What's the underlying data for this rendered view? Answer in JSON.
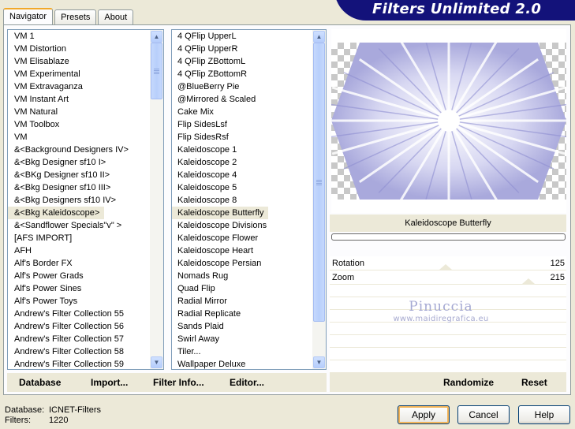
{
  "tabs": [
    "Navigator",
    "Presets",
    "About"
  ],
  "title": "Filters Unlimited 2.0",
  "categories": {
    "items": [
      "VM 1",
      "VM Distortion",
      "VM Elisablaze",
      "VM Experimental",
      "VM Extravaganza",
      "VM Instant Art",
      "VM Natural",
      "VM Toolbox",
      "VM",
      "&<Background Designers IV>",
      "&<Bkg Designer sf10 I>",
      "&<BKg Designer sf10 II>",
      "&<Bkg Designer sf10 III>",
      "&<Bkg Designers sf10 IV>",
      "&<Bkg Kaleidoscope>",
      "&<Sandflower Specials\"v\" >",
      "[AFS IMPORT]",
      "AFH",
      "Alf's Border FX",
      "Alf's Power Grads",
      "Alf's Power Sines",
      "Alf's Power Toys",
      "Andrew's Filter Collection 55",
      "Andrew's Filter Collection 56",
      "Andrew's Filter Collection 57",
      "Andrew's Filter Collection 58",
      "Andrew's Filter Collection 59"
    ],
    "selected_index": 14,
    "scroll_thumb_fraction": 0.1
  },
  "filters": {
    "items": [
      "4 QFlip UpperL",
      "4 QFlip UpperR",
      "4 QFlip ZBottomL",
      "4 QFlip ZBottomR",
      "@BlueBerry Pie",
      "@Mirrored & Scaled",
      "Cake Mix",
      "Flip SidesLsf",
      "Flip SidesRsf",
      "Kaleidoscope 1",
      "Kaleidoscope 2",
      "Kaleidoscope 4",
      "Kaleidoscope 5",
      "Kaleidoscope 8",
      "Kaleidoscope Butterfly",
      "Kaleidoscope Divisions",
      "Kaleidoscope Flower",
      "Kaleidoscope Heart",
      "Kaleidoscope Persian",
      "Nomads Rug",
      "Quad Flip",
      "Radial Mirror",
      "Radial Replicate",
      "Sands Plaid",
      "Swirl Away",
      "Tiler...",
      "Wallpaper Deluxe"
    ],
    "selected_index": 14
  },
  "preview": {
    "filter_name": "Kaleidoscope Butterfly",
    "progress_fraction": 0
  },
  "params": [
    {
      "label": "Rotation",
      "value": "125",
      "level": 0.49
    },
    {
      "label": "Zoom",
      "value": "215",
      "level": 0.84
    }
  ],
  "watermark": {
    "title": "Pinuccia",
    "subtitle": "www.maidiregrafica.eu"
  },
  "bottom_left_buttons": [
    "Database",
    "Import...",
    "Filter Info...",
    "Editor..."
  ],
  "bottom_right_buttons": [
    "Randomize",
    "Reset"
  ],
  "status": {
    "database_label": "Database:",
    "database_value": "ICNET-Filters",
    "filters_label": "Filters:",
    "filters_value": "1220"
  },
  "dialog_buttons": {
    "apply": "Apply",
    "cancel": "Cancel",
    "help": "Help"
  },
  "colors": {
    "accent": "#13127a",
    "selection": "#ece9d8",
    "pattern": "#b9b9e6"
  }
}
